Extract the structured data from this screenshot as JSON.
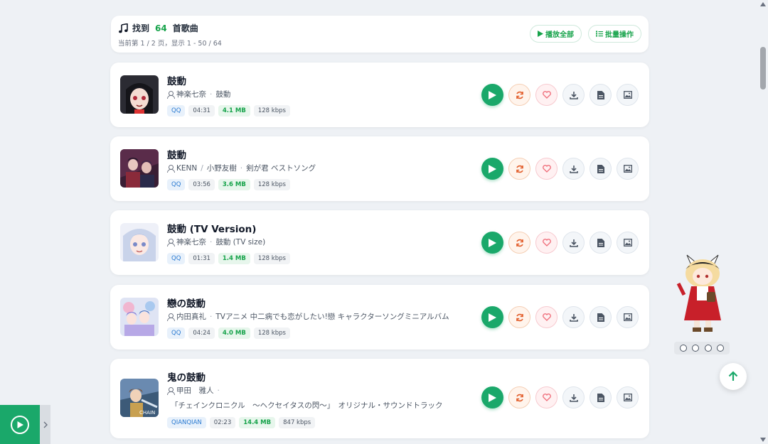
{
  "header": {
    "title_prefix": "找到",
    "count": "64",
    "title_suffix": "首歌曲",
    "subtitle": "当前第 1 / 2 页，显示 1 - 50 / 64",
    "play_all_label": "播放全部",
    "batch_label": "批量操作"
  },
  "songs": [
    {
      "title": "鼓動",
      "artist": "神楽七奈",
      "album": "鼓動",
      "source": "QQ",
      "duration": "04:31",
      "size": "4.1 MB",
      "bitrate": "128 kbps"
    },
    {
      "title": "鼓動",
      "artist_1": "KENN",
      "artist_2": "小野友樹",
      "album": "剣が君 ベストソング",
      "source": "QQ",
      "duration": "03:56",
      "size": "3.6 MB",
      "bitrate": "128 kbps"
    },
    {
      "title": "鼓動 (TV Version)",
      "artist": "神楽七奈",
      "album": "鼓動 (TV size)",
      "source": "QQ",
      "duration": "01:31",
      "size": "1.4 MB",
      "bitrate": "128 kbps"
    },
    {
      "title": "戀の鼓動",
      "artist": "内田真礼",
      "album": "TVアニメ 中二病でも恋がしたい!戀 キャラクターソングミニアルバム",
      "source": "QQ",
      "duration": "04:24",
      "size": "4.0 MB",
      "bitrate": "128 kbps"
    },
    {
      "title": "鬼の鼓動",
      "artist": "甲田　雅人",
      "album": "「チェインクロニクル　～ヘクセイタスの閃～」　オリジナル・サウンドトラック",
      "source": "QIANQIAN",
      "duration": "02:23",
      "size": "14.4 MB",
      "bitrate": "847 kbps"
    }
  ],
  "icons": {
    "header": "music-note-icon",
    "play": "play-icon",
    "swap": "swap-icon",
    "like": "heart-icon",
    "download": "download-icon",
    "lyrics": "document-icon",
    "cover": "image-icon",
    "to_top": "arrow-up-icon"
  },
  "colors": {
    "accent": "#1aa86a",
    "swap": "#e25d2a",
    "like": "#ef6b78",
    "source_tag": "#2b7bd1"
  }
}
